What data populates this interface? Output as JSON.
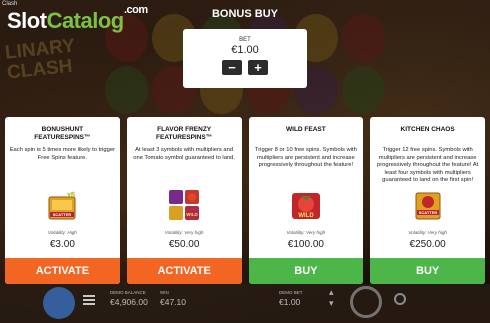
{
  "window": {
    "title": "Clash"
  },
  "logo": {
    "part1": "Slot",
    "part2": "Catalog",
    "suffix": ".com"
  },
  "background": {
    "title_line1": "LINARY",
    "title_line2": "CLASH"
  },
  "header": {
    "title": "BONUS BUY"
  },
  "bet": {
    "label": "BET",
    "value": "€1.00",
    "minus_label": "−",
    "plus_label": "+"
  },
  "cards": [
    {
      "title_line1": "BONUSHUNT",
      "title_line2": "FEATURESPINS™",
      "description": "Each spin is 5 times more likely to trigger Free Spins feature.",
      "icon_text": "SCATTER",
      "icon_badge": "x5",
      "volatility": "Volatility: High",
      "price": "€3.00",
      "button_label": "ACTIVATE",
      "button_color": "#f26522"
    },
    {
      "title_line1": "FLAVOR FRENZY",
      "title_line2": "FEATURESPINS™",
      "description": "At least 3 symbols with multipliers and one Tomato symbol guaranteed to land.",
      "icon_text": "WILD",
      "volatility": "Volatility: Very high",
      "price": "€50.00",
      "button_label": "ACTIVATE",
      "button_color": "#f26522"
    },
    {
      "title_line1": "WILD FEAST",
      "title_line2": "",
      "description": "Trigger 8 or 10 free spins. Symbols with multipliers are persistent and increase progressively throughout the feature!",
      "icon_text": "WILD",
      "volatility": "Volatility: Very high",
      "price": "€100.00",
      "button_label": "BUY",
      "button_color": "#4cb648"
    },
    {
      "title_line1": "KITCHEN CHAOS",
      "title_line2": "",
      "description": "Trigger 12 free spins. Symbols with multipliers are persistent and increase progressively throughout the feature! At least four symbols with multipliers guaranteed to land on the first spin!",
      "icon_text": "SCATTER",
      "volatility": "Volatility: Very high",
      "price": "€250.00",
      "button_label": "BUY",
      "button_color": "#4cb648"
    }
  ],
  "bottom_bar": {
    "balance_label": "DEMO BALANCE",
    "balance_value": "€4,906.00",
    "win_label": "WIN",
    "win_value": "€47.10",
    "bet_label": "DEMO BET",
    "bet_value": "€1.00"
  },
  "icons": {
    "menu": "menu-icon",
    "spin": "spin-icon",
    "settings": "settings-icon",
    "bet_up": "chevron-up-icon",
    "bet_down": "chevron-down-icon"
  }
}
